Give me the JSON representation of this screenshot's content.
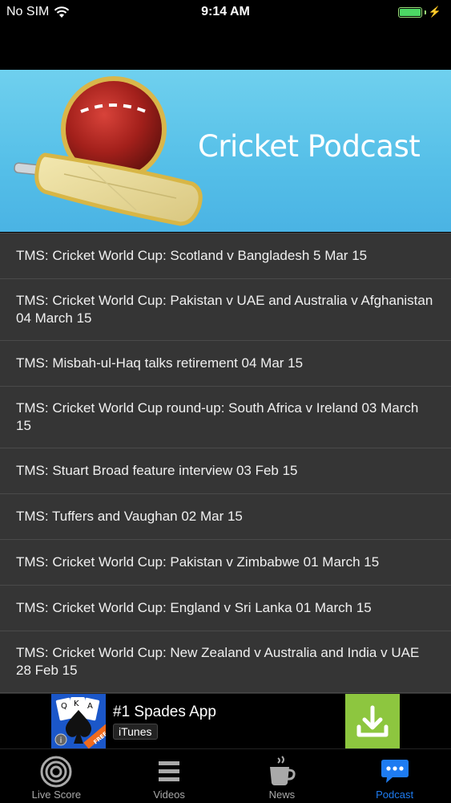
{
  "status_bar": {
    "carrier": "No SIM",
    "time": "9:14 AM",
    "battery_level": 1.0
  },
  "banner": {
    "title": "Cricket Podcast"
  },
  "podcasts": [
    "TMS: Cricket World Cup: Scotland v Bangladesh 5 Mar 15",
    "TMS: Cricket World Cup: Pakistan v UAE and Australia v Afghanistan 04 March 15",
    "TMS: Misbah-ul-Haq talks retirement 04 Mar 15",
    "TMS: Cricket World Cup round-up: South Africa v Ireland 03 March 15",
    "TMS: Stuart Broad feature interview 03 Feb 15",
    "TMS: Tuffers and Vaughan 02 Mar 15",
    "TMS: Cricket World Cup: Pakistan v Zimbabwe 01 March 15",
    "TMS: Cricket World Cup: England v Sri Lanka 01 March 15",
    "TMS: Cricket World Cup: New Zealand v Australia and India v UAE 28 Feb 15"
  ],
  "ad": {
    "title": "#1 Spades App",
    "store": "iTunes",
    "icon": "spades-app-icon",
    "action_icon": "download-icon",
    "action_color": "#8dc63f",
    "card_ranks": [
      "Q",
      "K",
      "A"
    ],
    "free_label": "FREE"
  },
  "tabs": [
    {
      "label": "Live Score",
      "icon": "target-icon"
    },
    {
      "label": "Videos",
      "icon": "list-icon"
    },
    {
      "label": "News",
      "icon": "coffee-cup-icon"
    },
    {
      "label": "Podcast",
      "icon": "speech-bubble-icon",
      "active": true
    }
  ],
  "colors": {
    "accent": "#1e7cf2",
    "banner": "#55bfe8",
    "row_bg": "#353535"
  }
}
